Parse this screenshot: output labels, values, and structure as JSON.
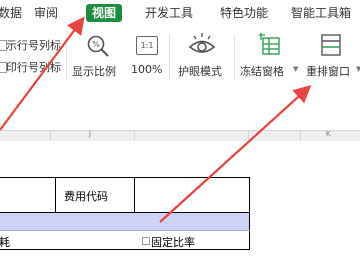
{
  "menu": {
    "items": [
      "数据",
      "审阅",
      "视图",
      "开发工具",
      "特色功能",
      "智能工具箱"
    ],
    "active": "视图"
  },
  "ribbon": {
    "left_checkbox_1": "示行号列标",
    "left_checkbox_2": "印行号列标",
    "zoom_label": "显示比例",
    "zoom_value": "100%",
    "zoom_icon_text": "1:1",
    "eye_label": "护眼模式",
    "freeze_label": "冻结窗格",
    "rearrange_label": "重排窗口"
  },
  "column_header": {
    "j_label": "J",
    "k_label": "K"
  },
  "sheet": {
    "header_cell": "费用代码",
    "row_text_left": "耗",
    "row_text_right": "固定比率"
  },
  "colors": {
    "active_tab": "#1a8d3e",
    "arrow": "#e8433d",
    "highlight_row": "#cfd2f7",
    "icon_green": "#2fa34f"
  }
}
